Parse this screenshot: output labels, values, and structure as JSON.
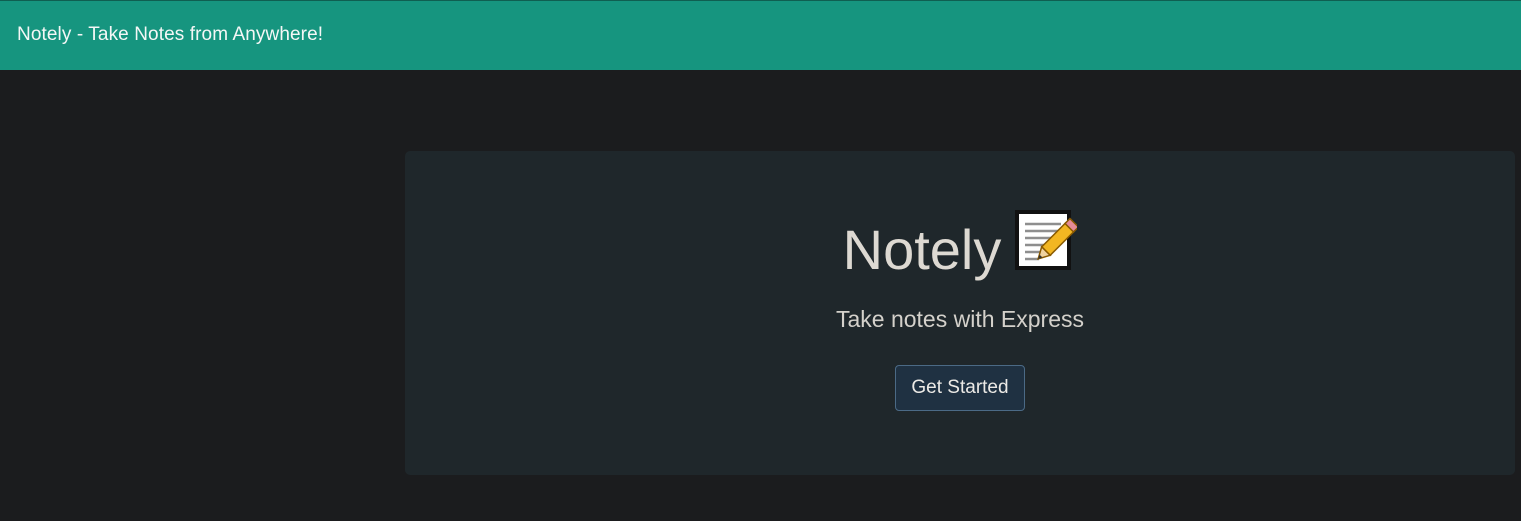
{
  "navbar": {
    "brand": "Notely - Take Notes from Anywhere!",
    "background": "#16957f"
  },
  "hero": {
    "title": "Notely",
    "title_icon": "memo-pencil-icon",
    "lead": "Take notes with Express",
    "button_label": "Get Started",
    "button_color": "#1f3142"
  }
}
